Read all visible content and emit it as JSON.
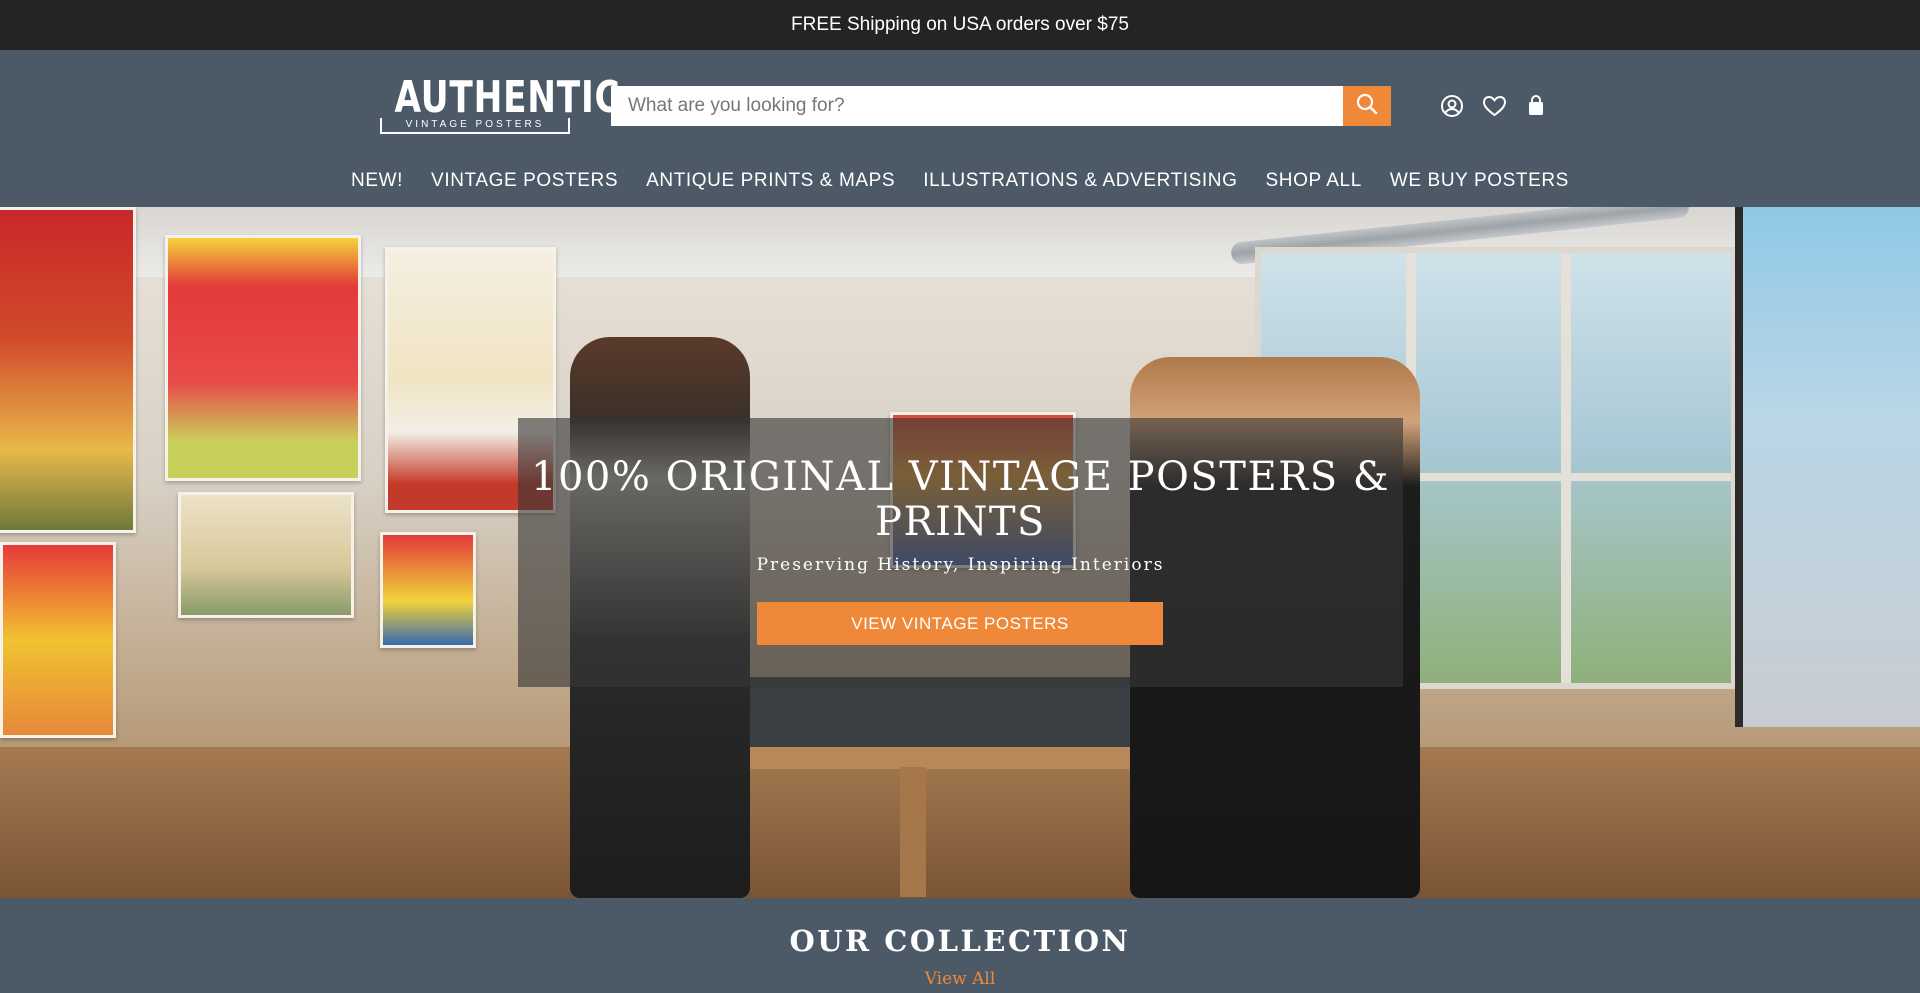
{
  "announcement": {
    "text": "FREE Shipping on USA orders over $75"
  },
  "logo": {
    "main": "AUTHENTIC",
    "sub": "VINTAGE POSTERS"
  },
  "search": {
    "placeholder": "What are you looking for?",
    "value": "",
    "icon": "search-icon"
  },
  "header_icons": [
    "account-icon",
    "wishlist-heart-icon",
    "cart-bag-icon"
  ],
  "nav": {
    "items": [
      {
        "label": "NEW!"
      },
      {
        "label": "VINTAGE POSTERS"
      },
      {
        "label": "ANTIQUE PRINTS & MAPS"
      },
      {
        "label": "ILLUSTRATIONS & ADVERTISING"
      },
      {
        "label": "SHOP ALL"
      },
      {
        "label": "WE BUY POSTERS"
      }
    ]
  },
  "hero": {
    "title": "100% ORIGINAL VINTAGE POSTERS & PRINTS",
    "subtitle": "Preserving History, Inspiring Interiors",
    "button_label": "VIEW VINTAGE POSTERS"
  },
  "collection": {
    "title": "OUR COLLECTION",
    "view_all": "View All"
  },
  "colors": {
    "accent": "#f0883a",
    "header_bg": "#4c5a67",
    "announce_bg": "#242424"
  }
}
